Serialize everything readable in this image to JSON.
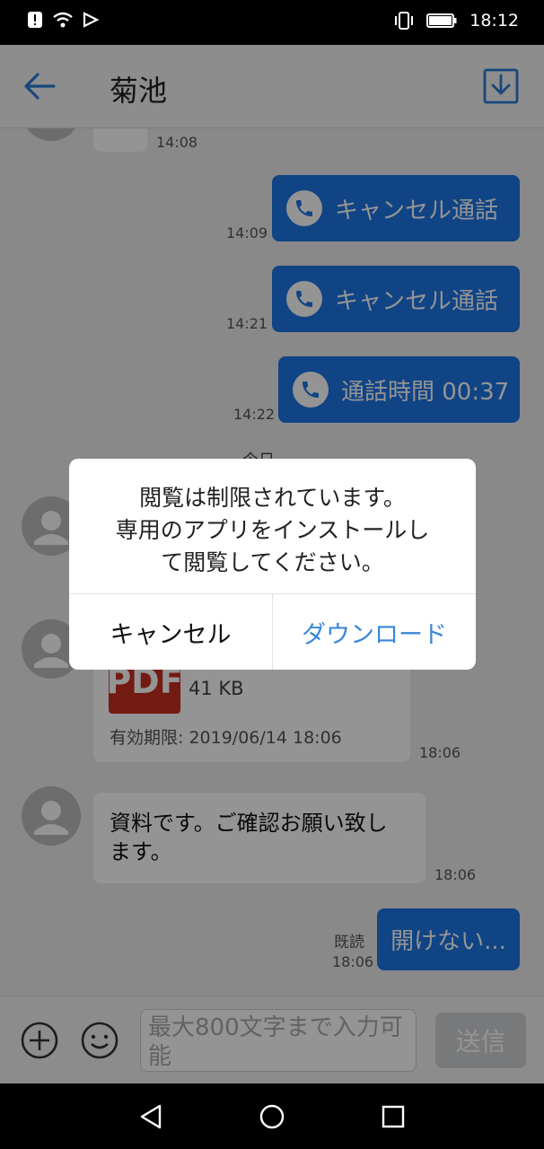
{
  "status_bar": {
    "time": "18:12"
  },
  "header": {
    "title": "菊池"
  },
  "messages": [
    {
      "time": "14:08"
    },
    {
      "text": "キャンセル通話",
      "time": "14:09"
    },
    {
      "text": "キャンセル通話",
      "time": "14:21"
    },
    {
      "text": "通話時間 00:37",
      "time": "14:22"
    }
  ],
  "date_divider": "今日",
  "file_message": {
    "badge": "PDF",
    "size": "41 KB",
    "expiry": "有効期限: 2019/06/14 18:06",
    "time": "18:06"
  },
  "text_message": {
    "text": "資料です。ご確認お願い致します。",
    "time": "18:06"
  },
  "my_last_message": {
    "read_label": "既読",
    "time": "18:06",
    "text": "開けない..."
  },
  "input": {
    "placeholder": "最大800文字まで入力可能",
    "send_label": "送信"
  },
  "dialog": {
    "message": "閲覧は制限されています。\n専用のアプリをインストールし\nて閲覧してください。",
    "cancel_label": "キャンセル",
    "download_label": "ダウンロード"
  },
  "colors": {
    "accent_blue": "#1d76e5",
    "dialog_link_blue": "#3a87d8",
    "pdf_red": "#c62d20",
    "header_icon_blue": "#2a7ad6"
  }
}
